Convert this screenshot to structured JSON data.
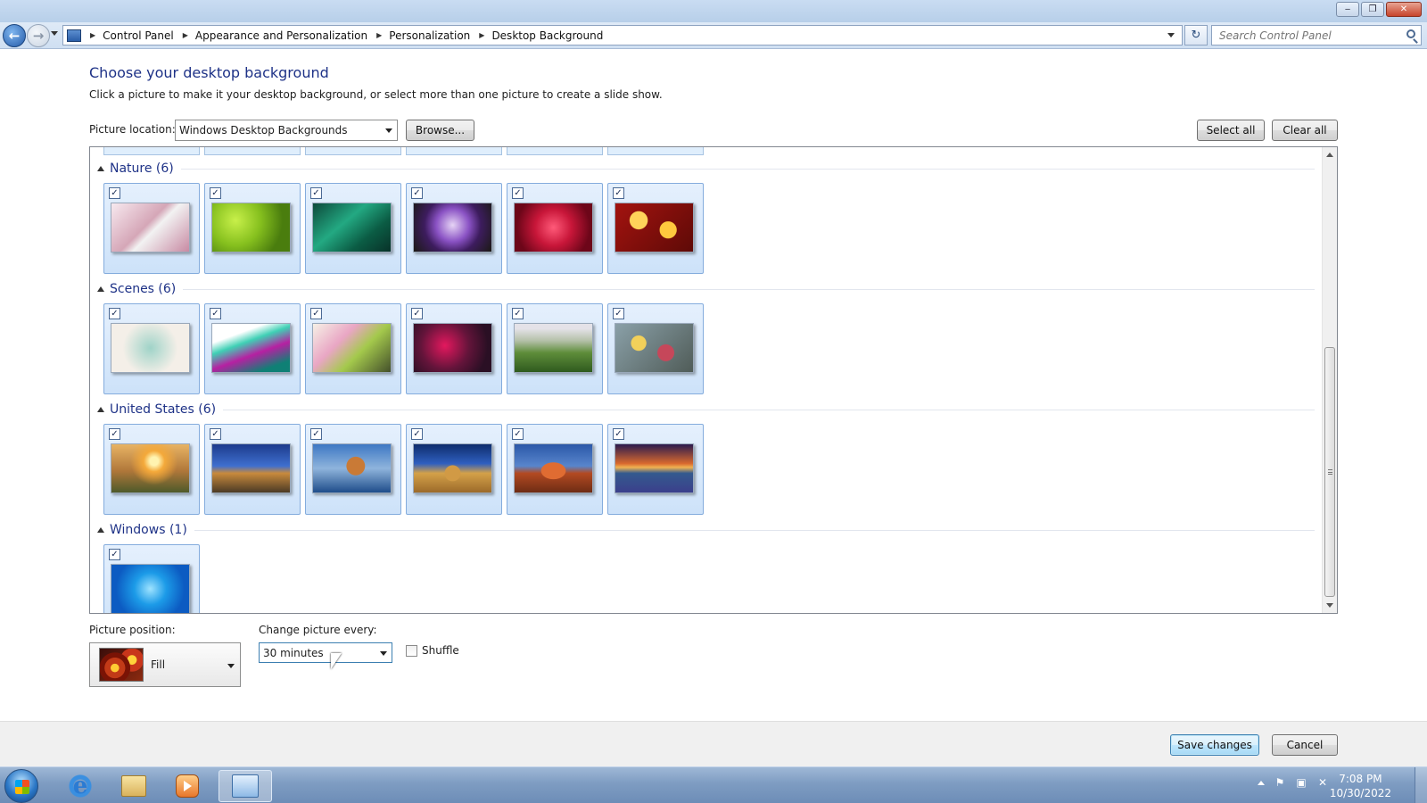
{
  "window": {
    "minimize_glyph": "‒",
    "restore_glyph": "❐",
    "close_glyph": "✕"
  },
  "address": {
    "back_glyph": "←",
    "forward_glyph": "→",
    "breadcrumbs": [
      "Control Panel",
      "Appearance and Personalization",
      "Personalization",
      "Desktop Background"
    ],
    "refresh_glyph": "↻",
    "search_placeholder": "Search Control Panel"
  },
  "page": {
    "title": "Choose your desktop background",
    "subtitle": "Click a picture to make it your desktop background, or select more than one picture to create a slide show.",
    "location_label": "Picture location:",
    "location_value": "Windows Desktop Backgrounds",
    "browse_label": "Browse...",
    "select_all_label": "Select all",
    "clear_all_label": "Clear all"
  },
  "groups": [
    {
      "title": "Nature (6)",
      "tiles": [
        {
          "checked": true,
          "gradient": "linear-gradient(135deg,#f7e9ef,#d5a6b7 45%,#f2f2f2 55%,#c88aa3)"
        },
        {
          "checked": true,
          "gradient": "radial-gradient(circle at 30% 35%,#c8f04a,#86c01e 40%,#4a7d0e 75%)"
        },
        {
          "checked": true,
          "gradient": "linear-gradient(140deg,#0d4a3b,#23a982 40%,#0b5c44 70%,#083229)"
        },
        {
          "checked": true,
          "gradient": "radial-gradient(circle at 50% 45%,#e6d4f5,#8a52c4 35%,#3d1c5e 60%,#1b1a14)"
        },
        {
          "checked": true,
          "gradient": "radial-gradient(circle at 50% 50%,#ff5a79,#c81639 40%,#6d0619 80%)"
        },
        {
          "checked": true,
          "gradient": "radial-gradient(circle at 30% 35%,#ffd35a 0 14%,transparent 15%),radial-gradient(circle at 68% 55%,#ffc83e 0 14%,transparent 15%),linear-gradient(135deg,#a3130f,#5e0a07)"
        }
      ]
    },
    {
      "title": "Scenes (6)",
      "tiles": [
        {
          "checked": true,
          "gradient": "radial-gradient(circle at 50% 50%,#9fd3c8,#f4efe8 60%)"
        },
        {
          "checked": true,
          "gradient": "linear-gradient(160deg,#ffffff 25%,#3fd0b5 40%,#b620a2 60%,#0f8075 85%)"
        },
        {
          "checked": true,
          "gradient": "linear-gradient(135deg,#f6f1e6,#e9a6c4 35%,#a4c94c 60%,#44502b)"
        },
        {
          "checked": true,
          "gradient": "radial-gradient(circle at 40% 45%,#e3185e,#63143a 45%,#2a0f24 80%)"
        },
        {
          "checked": true,
          "gradient": "linear-gradient(#e4e2e8 10%,#b4c0a8 35%,#5e8d3a 60%,#2f5a1e)"
        },
        {
          "checked": true,
          "gradient": "radial-gradient(circle at 30% 40%,#f2d05a 0 12%,transparent 13%),radial-gradient(circle at 65% 60%,#c6475a 0 14%,transparent 15%),linear-gradient(135deg,#8aa0a8,#505c58)"
        }
      ]
    },
    {
      "title": "United States (6)",
      "tiles": [
        {
          "checked": true,
          "gradient": "radial-gradient(circle at 55% 35%,#fff3b0 0 8%,#f4a93a 20%,transparent 45%),linear-gradient(#e8b364,#b0773a 55%,#4e5a2a)"
        },
        {
          "checked": true,
          "gradient": "linear-gradient(#1d3b8c 0%,#3e6fcf 45%,#c88a3d 60%,#4b3a25 100%)"
        },
        {
          "checked": true,
          "gradient": "radial-gradient(circle at 55% 45%,#c97a36 0 18%,transparent 19%),linear-gradient(#3e78c4,#8fb4dc 50%,#1f4d8a)"
        },
        {
          "checked": true,
          "gradient": "radial-gradient(circle at 50% 60%,#d19a45 0 16%,transparent 17%),linear-gradient(#0e2d6c,#2f5fbf 40%,#d4a149 60%,#9c6a2a)"
        },
        {
          "checked": true,
          "gradient": "radial-gradient(ellipse at 50% 55%,#e06c32 0 22%,transparent 23%),linear-gradient(#2b58a8,#5885cc 45%,#b34a22 60%,#6e2c14)"
        },
        {
          "checked": true,
          "gradient": "linear-gradient(#2b1a4e,#d96a2e 40%,#f0b352 48%,#345a8e 60%,#3b3f8c)"
        }
      ]
    },
    {
      "title": "Windows (1)",
      "tiles": [
        {
          "checked": true,
          "gradient": "radial-gradient(circle at 50% 50%,#9fe3ff,#1c9be8 35%,#0c5bc2 75%)"
        }
      ]
    }
  ],
  "bottom": {
    "position_label": "Picture position:",
    "position_value": "Fill",
    "change_label": "Change picture every:",
    "change_value": "30 minutes",
    "shuffle_label": "Shuffle",
    "shuffle_checked": false
  },
  "footer": {
    "save_label": "Save changes",
    "cancel_label": "Cancel"
  },
  "taskbar": {
    "ie_glyph": "e",
    "flag_glyph": "⚑",
    "network_glyph": "▣",
    "volume_glyph": "✕",
    "time": "7:08 PM",
    "date": "10/30/2022"
  }
}
